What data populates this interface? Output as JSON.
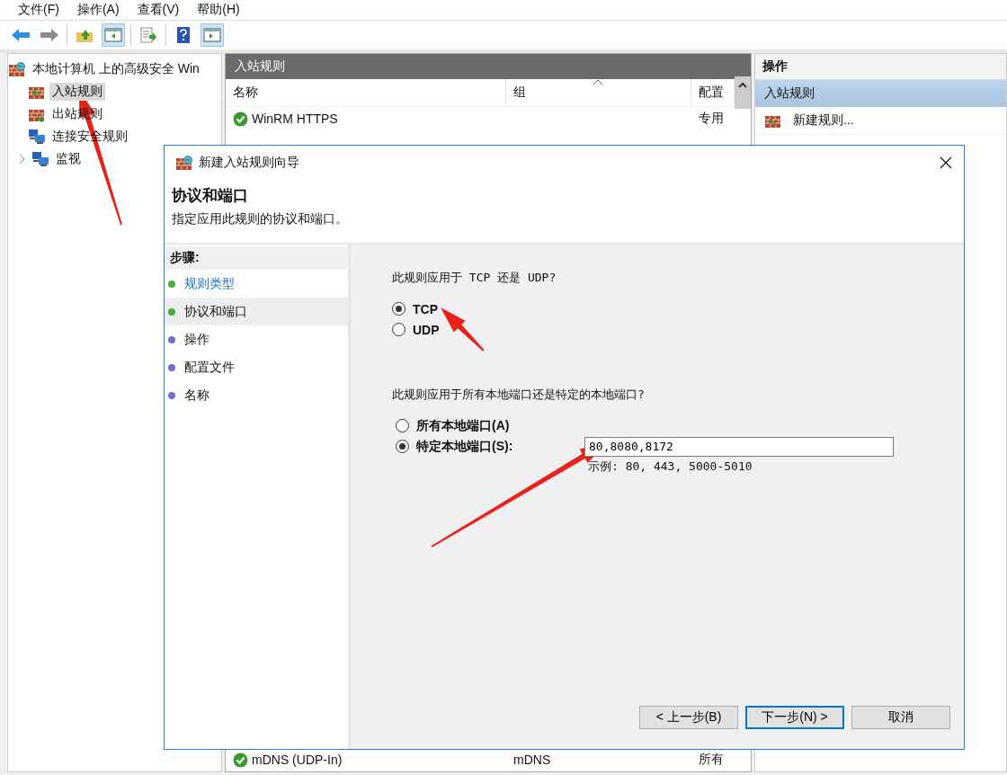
{
  "menu": [
    "文件(F)",
    "操作(A)",
    "查看(V)",
    "帮助(H)"
  ],
  "tree": {
    "label": "本地计算机 上的高级安全 Win",
    "children": [
      {
        "label": "入站规则",
        "selected": true
      },
      {
        "label": "出站规则",
        "selected": false
      },
      {
        "label": "连接安全规则",
        "selected": false
      },
      {
        "label": "监视",
        "selected": false,
        "expanded": false
      }
    ]
  },
  "rules_pane": {
    "title": "入站规则",
    "columns": [
      "名称",
      "组",
      "配置"
    ],
    "rows": [
      {
        "name": "WinRM HTTPS",
        "profile": "专用",
        "enabled": true
      }
    ],
    "bottom_rows": [
      {
        "name": "mDNS (UDP-In)",
        "group": "mDNS",
        "profile": "所有",
        "enabled": true
      }
    ]
  },
  "actions_pane": {
    "title": "操作",
    "section": "入站规则",
    "section_selected": true,
    "items": [
      "新建规则..."
    ]
  },
  "dialog": {
    "title": "新建入站规则向导",
    "heading": "协议和端口",
    "subtitle": "指定应用此规则的协议和端口。",
    "steps_title": "步骤:",
    "steps": [
      {
        "label": "规则类型",
        "color": "#45b03a",
        "link": true,
        "selected": false
      },
      {
        "label": "协议和端口",
        "color": "#45b03a",
        "link": false,
        "selected": true
      },
      {
        "label": "操作",
        "color": "#6a6fd0",
        "link": false,
        "selected": false
      },
      {
        "label": "配置文件",
        "color": "#6a6fd0",
        "link": false,
        "selected": false
      },
      {
        "label": "名称",
        "color": "#6a6fd0",
        "link": false,
        "selected": false
      }
    ],
    "protocol_question": "此规则应用于 TCP 还是 UDP?",
    "protocols": [
      {
        "label": "TCP",
        "selected": true
      },
      {
        "label": "UDP",
        "selected": false
      }
    ],
    "port_question": "此规则应用于所有本地端口还是特定的本地端口?",
    "port_options": [
      {
        "label": "所有本地端口(A)",
        "selected": false
      },
      {
        "label": "特定本地端口(S):",
        "selected": true
      }
    ],
    "ports_field": {
      "value": "80,8080,8172"
    },
    "ports_example": "示例: 80, 443, 5000-5010",
    "buttons": [
      {
        "label": "< 上一步(B)",
        "default": false
      },
      {
        "label": "下一步(N) >",
        "default": true
      },
      {
        "label": "取消",
        "default": false
      }
    ]
  }
}
